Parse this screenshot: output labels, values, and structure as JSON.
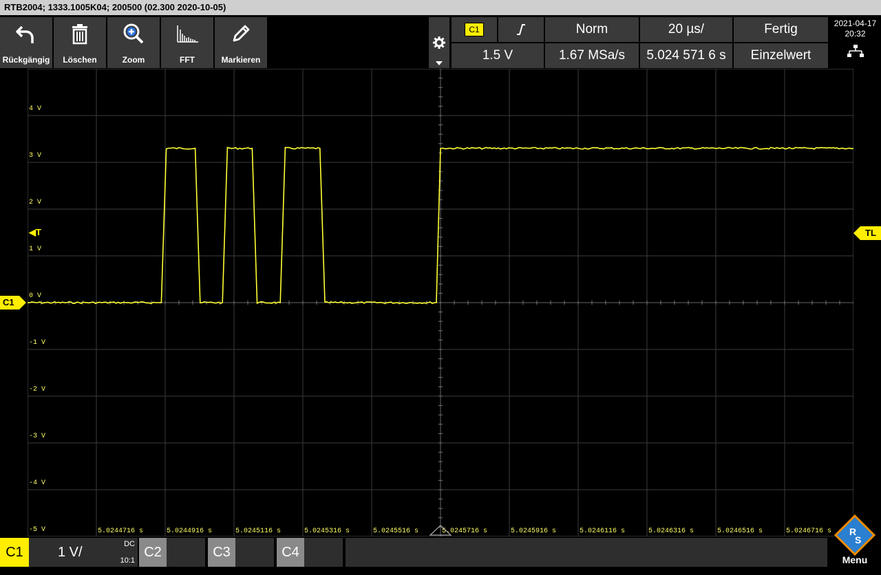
{
  "title": "RTB2004; 1333.1005K04; 200500 (02.300 2020-10-05)",
  "toolbar": {
    "undo": "Rückgängig",
    "delete": "Löschen",
    "zoom": "Zoom",
    "fft": "FFT",
    "mark": "Markieren"
  },
  "trigger": {
    "source": "C1",
    "slope_icon": "rising-edge-icon",
    "mode": "Norm",
    "level": "1.5 V"
  },
  "timebase": {
    "scale": "20 µs/",
    "sample_rate": "1.67 MSa/s",
    "position": "5.024 571 6 s"
  },
  "acquisition": {
    "status": "Fertig",
    "mode": "Einzelwert"
  },
  "datetime": {
    "date": "2021-04-17",
    "time": "20:32"
  },
  "axis": {
    "y_labels": [
      "4 V",
      "3 V",
      "2 V",
      "1 V",
      "0 V",
      "-1 V",
      "-2 V",
      "-3 V",
      "-4 V",
      "-5 V"
    ],
    "x_labels": [
      "5.0244716 s",
      "5.0244916 s",
      "5.0245116 s",
      "5.0245316 s",
      "5.0245516 s",
      "5.0245716 s",
      "5.0245916 s",
      "5.0246116 s",
      "5.0246316 s",
      "5.0246516 s",
      "5.0246716 s"
    ]
  },
  "markers": {
    "channel": "C1",
    "trigger_level_label": "TL",
    "trigger_tag": "◀T"
  },
  "channels": {
    "c1_label": "C1",
    "c1_scale": "1 V/",
    "c1_coupling": "DC",
    "c1_probe": "10:1",
    "c2_label": "C2",
    "c3_label": "C3",
    "c4_label": "C4"
  },
  "menu_label": "Menu",
  "colors": {
    "trace": "#ffff33",
    "grid": "#444444",
    "button_bg": "#3a3a3a"
  },
  "chart_data": {
    "type": "line",
    "x_unit": "µs",
    "y_unit": "V",
    "xlim": [
      -100,
      100
    ],
    "ylim": [
      -5,
      5
    ],
    "series": [
      {
        "color": "#ffff33",
        "x": [
          -100,
          -67.6,
          -66.4,
          -59.4,
          -58.2,
          -52.8,
          -51.6,
          -45.6,
          -44.4,
          -38.8,
          -37.6,
          -29.2,
          -28.0,
          -1.0,
          0,
          100
        ],
        "y": [
          0,
          0,
          3.3,
          3.3,
          0,
          0,
          3.3,
          3.3,
          0,
          0,
          3.3,
          3.3,
          0,
          0,
          3.3,
          3.3
        ]
      }
    ]
  }
}
